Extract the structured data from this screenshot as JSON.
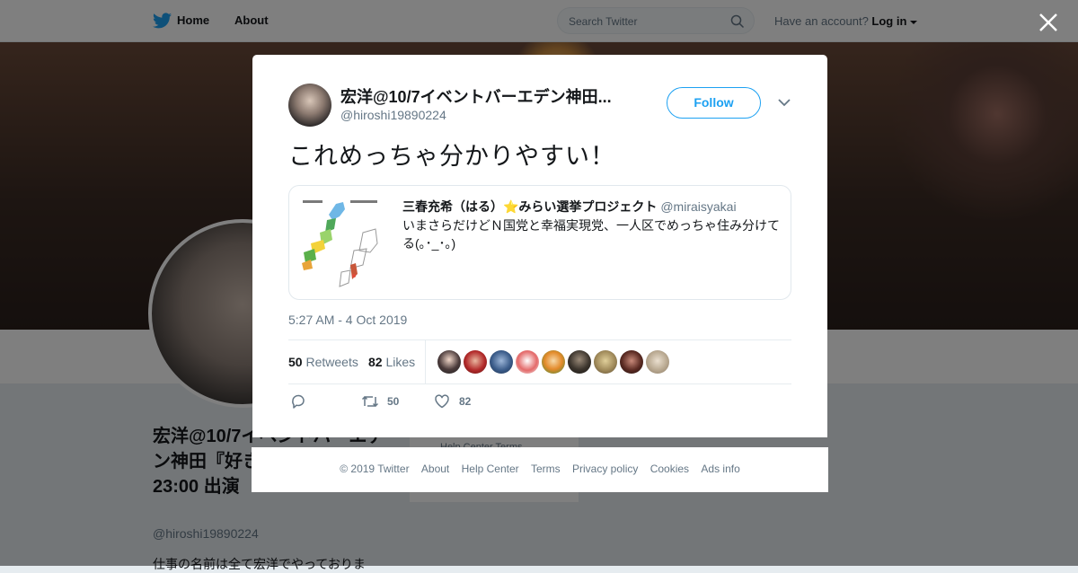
{
  "header": {
    "home_label": "Home",
    "about_label": "About",
    "search_placeholder": "Search Twitter",
    "have_account_text": "Have an account?",
    "login_label": "Log in"
  },
  "background_profile": {
    "name": "宏洋@10/7イベントバーエデン神田『好きバー』19:00〜23:00 出演",
    "handle": "@hiroshi19890224",
    "bio_start": "仕事の名前は全て宏洋でやっておりま",
    "side_links": "Help Center   Terms"
  },
  "tweet": {
    "author_name": "宏洋@10/7イベントバーエデン神田...",
    "author_handle": "@hiroshi19890224",
    "follow_label": "Follow",
    "text": "これめっちゃ分かりやすい！",
    "quoted": {
      "name": "三春充希（はる）⭐みらい選挙プロジェクト",
      "handle": "@miraisyakai",
      "text": "いまさらだけどＮ国党と幸福実現党、一人区でめっちゃ住み分けてる(｡･_･｡)"
    },
    "timestamp": "5:27 AM - 4 Oct 2019",
    "retweets_count": "50",
    "retweets_label": "Retweets",
    "likes_count": "82",
    "likes_label": "Likes",
    "action_retweets": "50",
    "action_likes": "82"
  },
  "footer": {
    "copyright": "© 2019 Twitter",
    "about": "About",
    "help_center": "Help Center",
    "terms": "Terms",
    "privacy": "Privacy policy",
    "cookies": "Cookies",
    "ads_info": "Ads info"
  },
  "icons": [
    "twitter-bird-icon",
    "search-icon",
    "caret-down-icon",
    "close-icon",
    "reply-icon",
    "retweet-icon",
    "like-icon"
  ],
  "colors": {
    "accent": "#1da1f2",
    "text": "#14171a",
    "muted": "#657786"
  }
}
